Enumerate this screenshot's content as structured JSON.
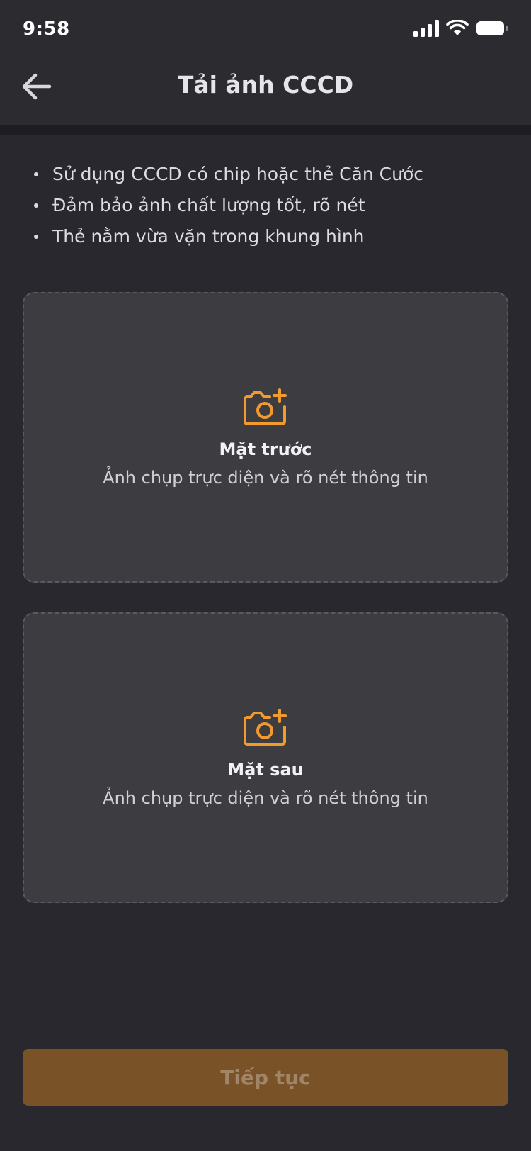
{
  "status_bar": {
    "time": "9:58",
    "icons": [
      "cellular-signal-icon",
      "wifi-icon",
      "battery-icon"
    ]
  },
  "header": {
    "title": "Tải ảnh CCCD",
    "back_icon": "arrow-left-icon"
  },
  "guidelines": [
    "Sử dụng CCCD có chip hoặc thẻ Căn Cước",
    "Đảm bảo ảnh chất lượng tốt, rõ nét",
    "Thẻ nằm vừa vặn trong khung hình"
  ],
  "upload_cards": {
    "front": {
      "title": "Mặt trước",
      "subtitle": "Ảnh chụp trực diện và rõ nét thông tin",
      "icon": "camera-add-icon"
    },
    "back": {
      "title": "Mặt sau",
      "subtitle": "Ảnh chụp trực diện và rõ nét thông tin",
      "icon": "camera-add-icon"
    }
  },
  "footer": {
    "continue_label": "Tiếp tục"
  },
  "colors": {
    "background": "#28282e",
    "accent": "#f39a2c",
    "button_disabled": "#7a5228",
    "card": "#3c3c41"
  }
}
